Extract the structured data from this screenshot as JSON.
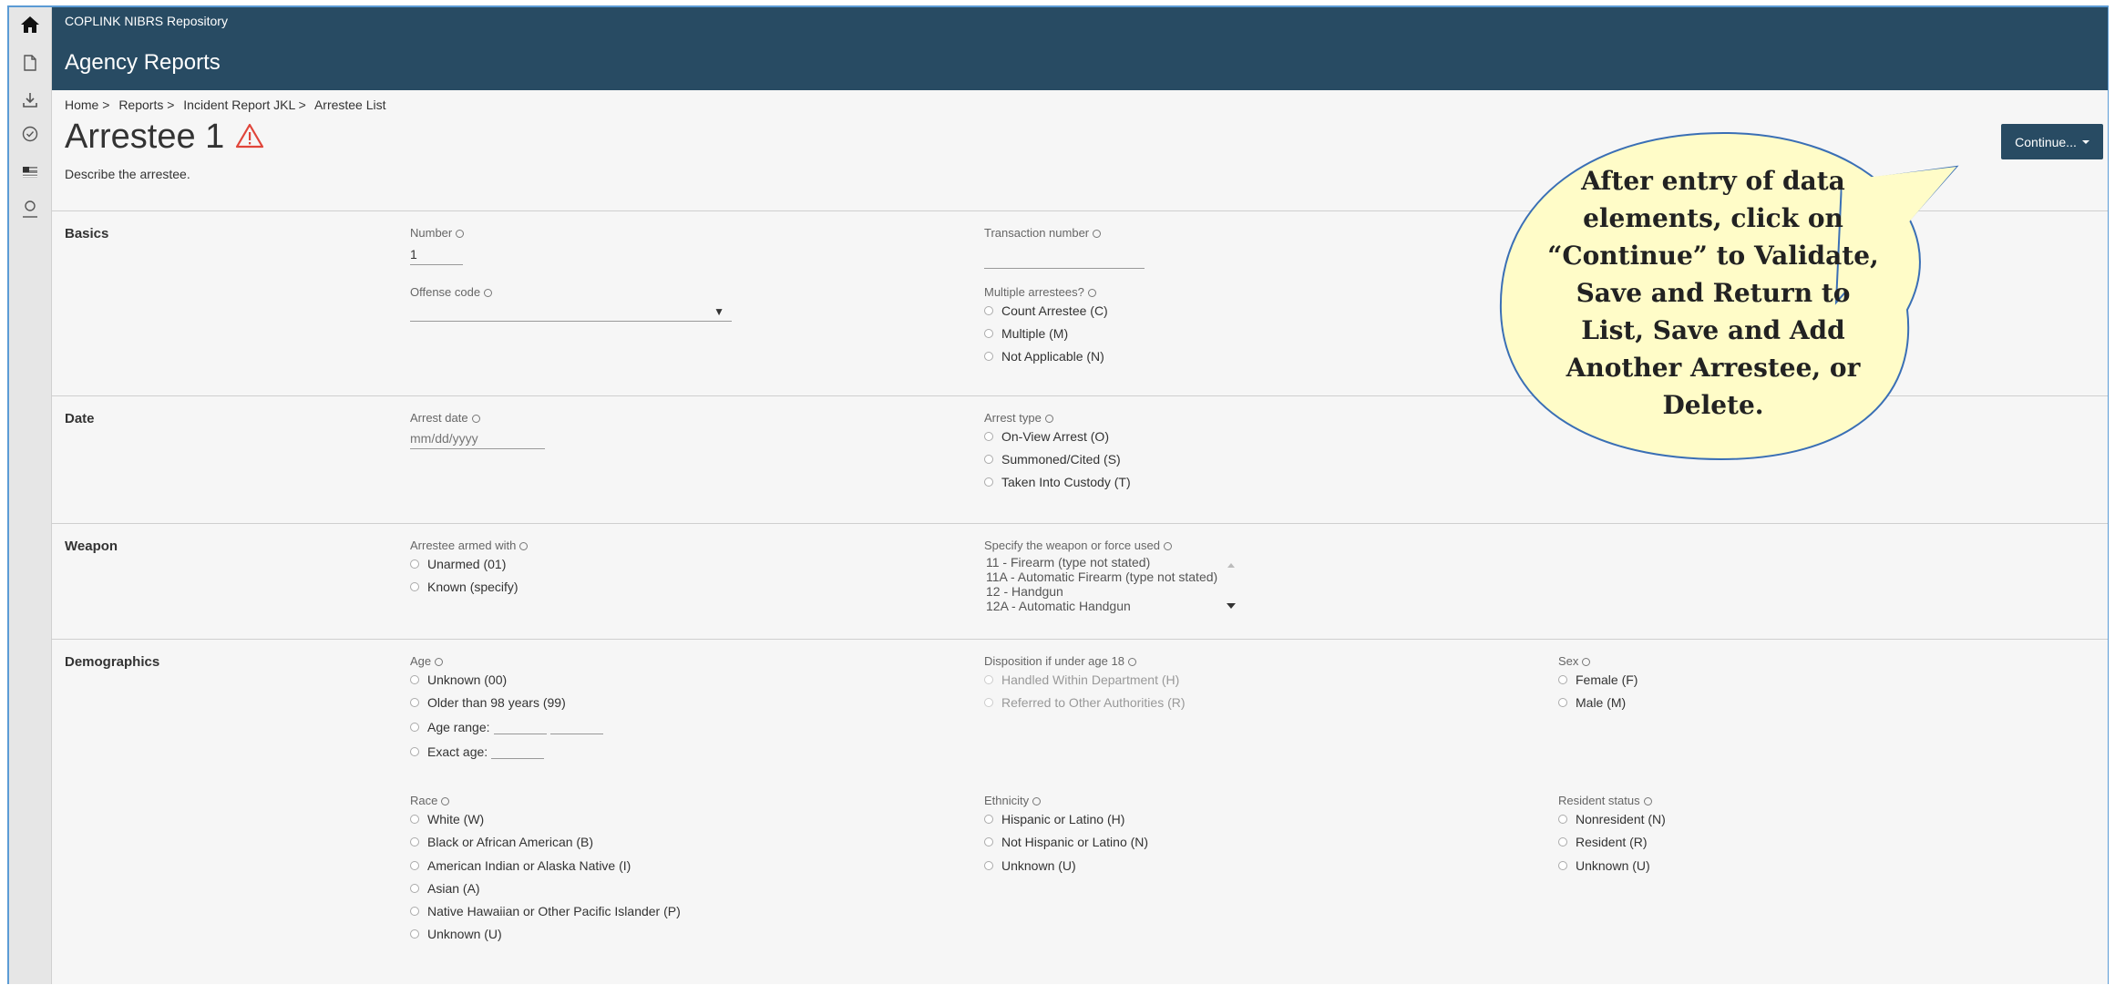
{
  "app": {
    "name": "COPLINK NIBRS Repository",
    "section_title": "Agency Reports"
  },
  "sidebar": [
    {
      "icon": "home-icon"
    },
    {
      "icon": "document-icon"
    },
    {
      "icon": "download-icon"
    },
    {
      "icon": "check-circle-icon"
    },
    {
      "icon": "flag-icon"
    },
    {
      "icon": "user-icon"
    }
  ],
  "breadcrumb": [
    "Home >",
    "Reports >",
    "Incident Report JKL >",
    "Arrestee List"
  ],
  "page": {
    "title": "Arrestee 1",
    "subtitle": "Describe the arrestee.",
    "continue_label": "Continue..."
  },
  "basics": {
    "title": "Basics",
    "number_label": "Number",
    "number_value": "1",
    "transaction_label": "Transaction number",
    "transaction_value": "",
    "offense_label": "Offense code",
    "multiple_label": "Multiple arrestees?",
    "multiple_options": [
      "Count Arrestee (C)",
      "Multiple (M)",
      "Not Applicable (N)"
    ]
  },
  "date": {
    "title": "Date",
    "arrest_date_label": "Arrest date",
    "arrest_date_placeholder": "mm/dd/yyyy",
    "arrest_type_label": "Arrest type",
    "arrest_type_options": [
      "On-View Arrest (O)",
      "Summoned/Cited (S)",
      "Taken Into Custody (T)"
    ]
  },
  "weapon": {
    "title": "Weapon",
    "armed_label": "Arrestee armed with",
    "armed_options": [
      "Unarmed (01)",
      "Known (specify)"
    ],
    "specify_label": "Specify the weapon or force used",
    "specify_list": [
      "11 - Firearm (type not stated)",
      "11A - Automatic Firearm (type not stated)",
      "12 - Handgun",
      "12A - Automatic Handgun"
    ]
  },
  "demographics": {
    "title": "Demographics",
    "age_label": "Age",
    "age_options": [
      "Unknown (00)",
      "Older than 98 years (99)",
      "Age range:",
      "Exact age:"
    ],
    "disposition_label": "Disposition if under age 18",
    "disposition_options": [
      "Handled Within Department (H)",
      "Referred to Other Authorities (R)"
    ],
    "sex_label": "Sex",
    "sex_options": [
      "Female (F)",
      "Male (M)"
    ],
    "race_label": "Race",
    "race_options": [
      "White (W)",
      "Black or African American (B)",
      "American Indian or Alaska Native (I)",
      "Asian (A)",
      "Native Hawaiian or Other Pacific Islander (P)",
      "Unknown (U)"
    ],
    "ethnicity_label": "Ethnicity",
    "ethnicity_options": [
      "Hispanic or Latino (H)",
      "Not Hispanic or Latino (N)",
      "Unknown (U)"
    ],
    "resident_label": "Resident status",
    "resident_options": [
      "Nonresident (N)",
      "Resident (R)",
      "Unknown (U)"
    ]
  },
  "callout": {
    "lines": [
      "After entry of data",
      "elements, click on",
      "“Continue” to Validate,",
      "Save and Return to",
      "List, Save and Add",
      "Another Arrestee, or",
      "Delete."
    ],
    "fill_color": "#fffcc8",
    "stroke_color": "#3a6fb5"
  }
}
